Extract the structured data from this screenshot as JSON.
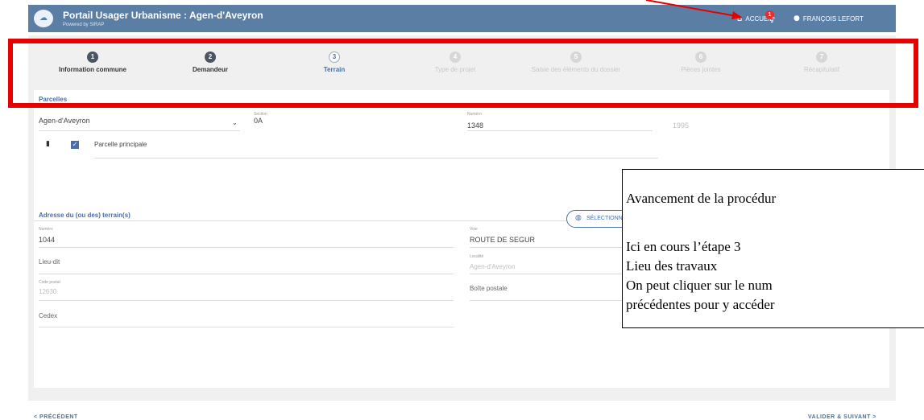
{
  "appbar": {
    "title": "Portail Usager Urbanisme : Agen-d'Aveyron",
    "subtitle": "Powered by SIRAP",
    "home_label": "ACCUEIL",
    "notif_count": "1",
    "user_label": "FRANÇOIS LEFORT"
  },
  "steps": [
    {
      "num": "1",
      "label": "Information commune",
      "state": "done"
    },
    {
      "num": "2",
      "label": "Demandeur",
      "state": "done"
    },
    {
      "num": "3",
      "label": "Terrain",
      "state": "current"
    },
    {
      "num": "4",
      "label": "Type de projet",
      "state": "todo"
    },
    {
      "num": "5",
      "label": "Saisie des éléments du dossier",
      "state": "todo"
    },
    {
      "num": "6",
      "label": "Pièces jointes",
      "state": "todo"
    },
    {
      "num": "7",
      "label": "Récapitulatif",
      "state": "todo"
    }
  ],
  "parcelles": {
    "title": "Parcelles",
    "commune_value": "Agen-d'Aveyron",
    "section_label": "Section",
    "section_value": "0A",
    "numero_label": "Numéro",
    "numero_value": "1348",
    "surface_value": "1995",
    "principale_label": "Parcelle principale"
  },
  "adresse": {
    "title": "Adresse du (ou des) terrain(s)",
    "numero_label": "Numéro",
    "numero_value": "1044",
    "voie_label": "Voie",
    "voie_value": "ROUTE DE SEGUR",
    "lieudit_label": "Lieu-dit",
    "localite_label": "Localité",
    "localite_value": "Agen-d'Aveyron",
    "cp_label": "Code postal",
    "cp_value": "12630",
    "bp_label": "Boîte postale",
    "cedex_label": "Cedex"
  },
  "select_button": "SÉLECTIONNER L",
  "footer": {
    "prev": "< PRÉCÉDENT",
    "next": "VALIDER & SUIVANT >"
  },
  "annotation": {
    "line1": "Avancement de la procédur",
    "line2": "Ici en cours l’étape 3",
    "line3": "Lieu des travaux",
    "line4": "On peut cliquer sur le num",
    "line5": "précédentes pour y accéder"
  },
  "colors": {
    "appbar": "#5a7ea4",
    "accent": "#4b6fa5",
    "highlight": "#e60000"
  }
}
